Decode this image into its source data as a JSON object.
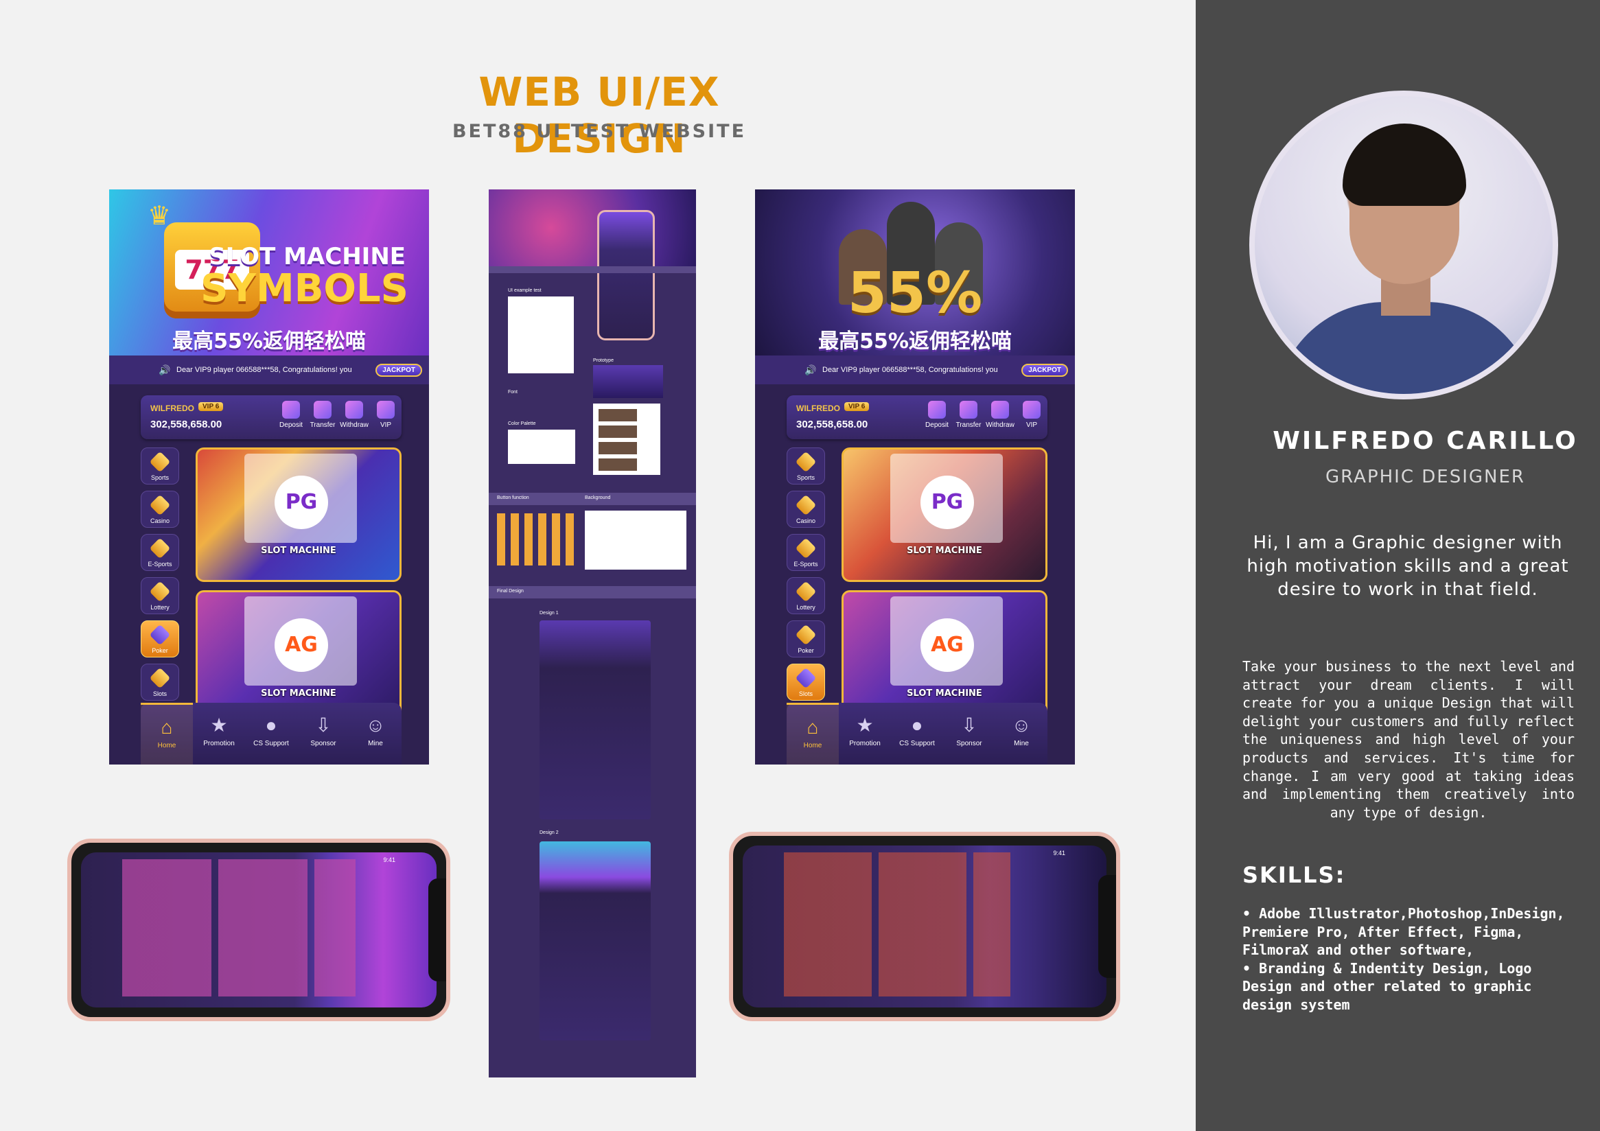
{
  "header": {
    "title": "WEB UI/EX DESIGN",
    "subtitle": "BET88 UI TEST WEBSITE"
  },
  "mock": {
    "banner_a_line1": "SLOT MACHINE",
    "banner_a_line2": "SYMBOLS",
    "banner_cn": "最高55%返佣轻松喵",
    "banner_b_big": "55%",
    "slot_digits": "777",
    "ticker_text": "Dear VIP9 player 066588***58, Congratulations! you",
    "jackpot": "JACKPOT",
    "user_name": "WILFREDO",
    "vip_level": "VIP 6",
    "balance": "302,558,658.00",
    "actions": [
      "Deposit",
      "Transfer",
      "Withdraw",
      "VIP"
    ],
    "categories": [
      "Sports",
      "Casino",
      "E-Sports",
      "Lottery",
      "Poker",
      "Slots"
    ],
    "card_label": "SLOT MACHINE",
    "pg_logo": "PG",
    "ag_logo": "AG",
    "tabs": [
      "Home",
      "Promotion",
      "CS Support",
      "Sponsor",
      "Mine"
    ]
  },
  "strip": {
    "ui_example": "UI example test",
    "prototype": "Prototype",
    "font_label": "Font",
    "color_palette": "Color Palette",
    "button_function": "Button function",
    "background": "Background",
    "final_design": "Final Design",
    "design1": "Design 1",
    "design2": "Design 2"
  },
  "landscape": {
    "time": "9:41"
  },
  "profile": {
    "name": "WILFREDO CARILLO",
    "role": "GRAPHIC DESIGNER",
    "intro": "Hi, I am a Graphic designer with high motivation skills and a great desire to work in that field.",
    "body": "Take your business to the next level and attract your dream clients. I will create for you a unique Design that will delight your customers and fully reflect the uniqueness and high level of your products and services. It's time for change. I am very good at taking ideas and implementing them creatively into any type of design.",
    "skills_heading": "SKILLS:",
    "skills": [
      "• Adobe Illustrator,Photoshop,InDesign, Premiere Pro, After Effect, Figma, FilmoraX and other software,",
      "• Branding & Indentity Design, Logo Design and other related to graphic design system"
    ]
  }
}
